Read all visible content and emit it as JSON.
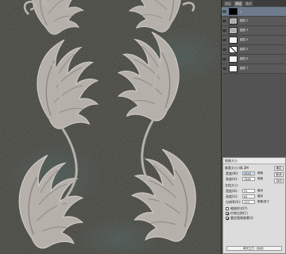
{
  "colors": {
    "canvas_bg": "#3e3d37",
    "leaf": "#b8b2ac",
    "panel_bg": "#535353",
    "selected_layer": "#6e7c8e",
    "dialog_bg": "#dcdcdc"
  },
  "panel": {
    "tabs": [
      "图层",
      "通道",
      "路径"
    ],
    "layers": [
      {
        "name": "1",
        "thumb": "black",
        "selected": true
      },
      {
        "name": "图层 2",
        "thumb": "pattern",
        "selected": false
      },
      {
        "name": "图层 3",
        "thumb": "pattern",
        "selected": false
      },
      {
        "name": "图层 4",
        "thumb": "white",
        "selected": false
      },
      {
        "name": "图层 5",
        "thumb": "xmark",
        "selected": false
      },
      {
        "name": "图层 6",
        "thumb": "white",
        "selected": false
      },
      {
        "name": "图层 7",
        "thumb": "white",
        "selected": false
      }
    ]
  },
  "dialog": {
    "title": "图像大小",
    "pixel_size": "像素大小:48.3M",
    "width_label": "宽度(W):",
    "width_value": "2010",
    "height_label": "高度(H):",
    "height_value": "7680",
    "unit_px": "像素",
    "doc_size": "文档大小:",
    "doc_width_label": "宽度(D):",
    "doc_width_value": "25",
    "doc_height_label": "高度(G):",
    "doc_height_value": "64",
    "unit_cm": "厘米",
    "resolution_label": "分辨率(R):",
    "resolution_value": "120",
    "resolution_unit": "像素/英寸",
    "scale_styles": "缩放样式(Y)",
    "constrain": "约束比例(C)",
    "resample": "重定图像像素(I):",
    "resample_method": "两次立方（自动）",
    "ok": "确定",
    "cancel": "取消",
    "auto": "自动"
  }
}
